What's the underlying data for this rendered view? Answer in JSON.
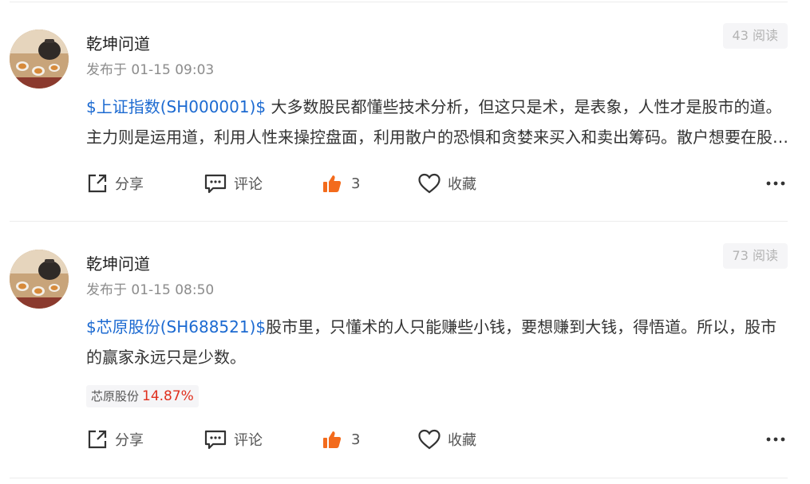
{
  "posts": [
    {
      "author": "乾坤问道",
      "published": "发布于 01-15 09:03",
      "reads": "43 阅读",
      "stock_link": "$上证指数(SH000001)$",
      "text": " 大多数股民都懂些技术分析，但这只是术，是表象，人性才是股市的道。主力则是运用道，利用人性来操控盘面，利用散户的恐惧和贪婪来买入和卖出筹码。散户想要在股市里赚钱，必须先悟道。",
      "actions": {
        "share": "分享",
        "comment": "评论",
        "like_count": "3",
        "favorite": "收藏"
      }
    },
    {
      "author": "乾坤问道",
      "published": "发布于 01-15 08:50",
      "reads": "73 阅读",
      "stock_link": "$芯原股份(SH688521)$",
      "text": "股市里，只懂术的人只能赚些小钱，要想赚到大钱，得悟道。所以，股市的赢家永远只是少数。",
      "tag": {
        "name": "芯原股份",
        "change": "14.87%",
        "change_color": "#e0301e"
      },
      "actions": {
        "share": "分享",
        "comment": "评论",
        "like_count": "3",
        "favorite": "收藏"
      }
    }
  ],
  "colors": {
    "link": "#1c6ad1",
    "like": "#f36b1c",
    "meta": "#8c8c8c"
  },
  "icons": [
    "share-icon",
    "comment-icon",
    "like-icon",
    "favorite-icon",
    "more-icon"
  ]
}
